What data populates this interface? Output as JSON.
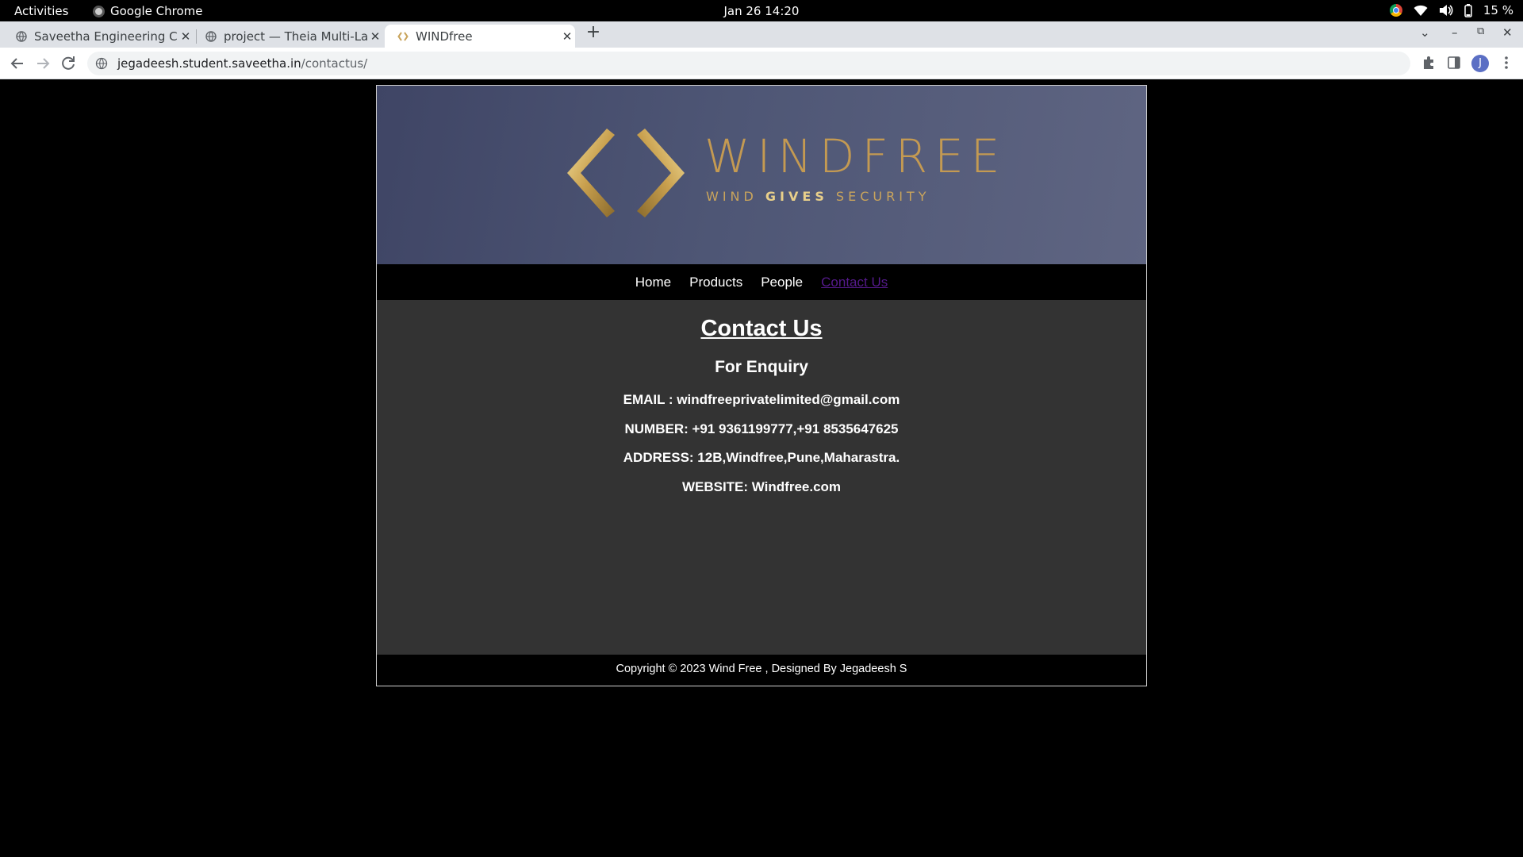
{
  "system_bar": {
    "activities": "Activities",
    "app_name": "Google Chrome",
    "clock": "Jan 26  14:20",
    "battery": "15 %"
  },
  "browser": {
    "tabs": [
      {
        "title": "Saveetha Engineering Co",
        "icon": "globe-icon",
        "active": false
      },
      {
        "title": "project — Theia Multi-Lan",
        "icon": "globe-icon",
        "active": false
      },
      {
        "title": "WINDfree",
        "icon": "windfree-favicon",
        "active": true
      }
    ],
    "url_host": "jegadeesh.student.saveetha.in",
    "url_path": "/contactus/",
    "profile_initial": "J"
  },
  "site": {
    "brand": "WINDFREE",
    "tagline_left": "WIND ",
    "tagline_bold": "GIVES",
    "tagline_right": " SECURITY",
    "nav": [
      {
        "label": "Home",
        "current": false
      },
      {
        "label": "Products",
        "current": false
      },
      {
        "label": "People",
        "current": false
      },
      {
        "label": "Contact Us",
        "current": true
      }
    ],
    "heading": "Contact Us",
    "subheading": "For Enquiry",
    "contact_lines": [
      "EMAIL : windfreeprivatelimited@gmail.com",
      "NUMBER: +91 9361199777,+91 8535647625",
      "ADDRESS: 12B,Windfree,Pune,Maharastra.",
      "WEBSITE: Windfree.com"
    ],
    "footer": "Copyright © 2023 Wind Free , Designed By Jegadeesh S"
  },
  "colors": {
    "banner": "#4e5675",
    "gold": "#c49a52",
    "content_bg": "#333333",
    "visited_link": "#551a8b"
  }
}
